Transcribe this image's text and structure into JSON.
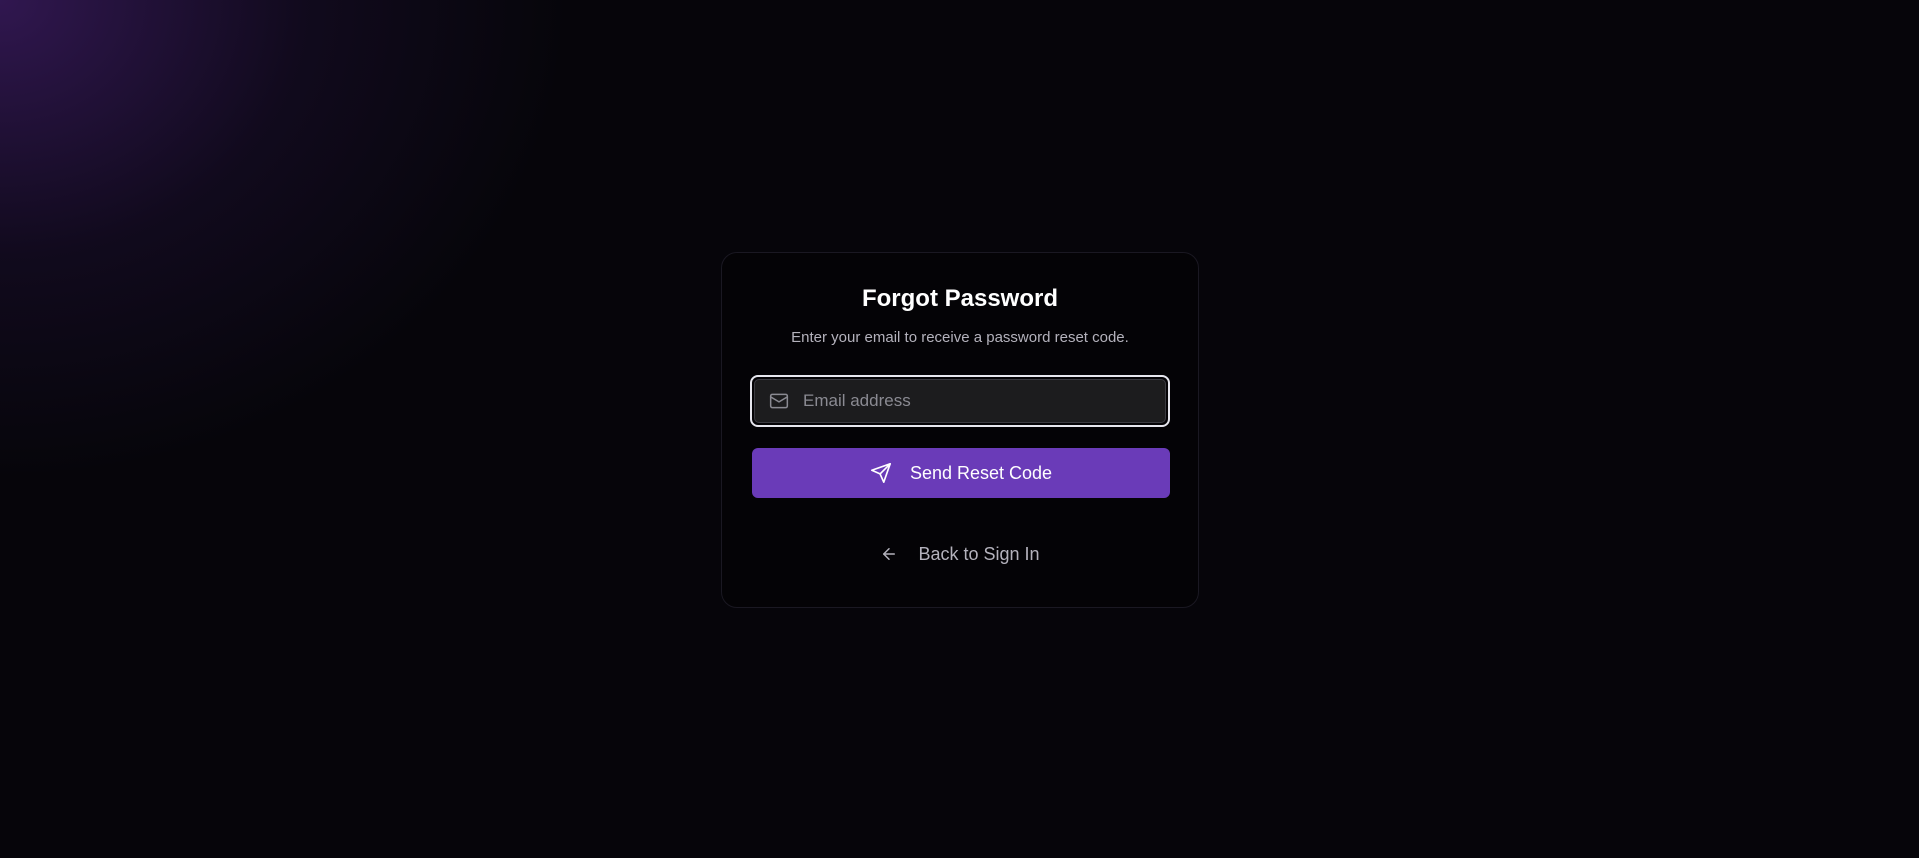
{
  "card": {
    "title": "Forgot Password",
    "subtitle": "Enter your email to receive a password reset code."
  },
  "email": {
    "placeholder": "Email address",
    "value": "",
    "icon": "mail-icon"
  },
  "send_button": {
    "label": "Send Reset Code",
    "icon": "send-icon"
  },
  "back_link": {
    "label": "Back to Sign In",
    "icon": "arrow-left-icon"
  },
  "colors": {
    "background": "#06050a",
    "accent": "#6a3bb8",
    "glow": "#381a5c",
    "card": "#040306",
    "input_bg": "#1c1c1e"
  }
}
